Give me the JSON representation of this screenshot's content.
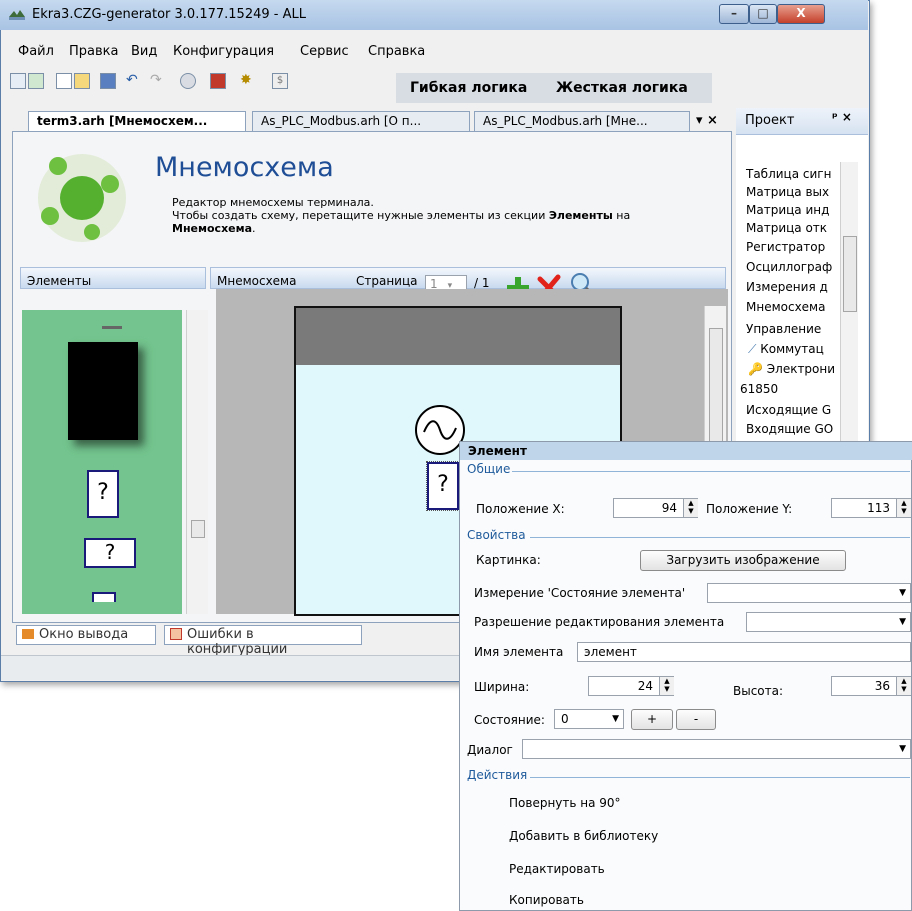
{
  "window": {
    "title": "Ekra3.CZG-generator 3.0.177.15249 - ALL",
    "min_label": "–",
    "max_label": "□",
    "close_label": "X"
  },
  "menu": [
    "Файл",
    "Правка",
    "Вид",
    "Конфигурация",
    "Сервис",
    "Справка"
  ],
  "toolbar": {
    "flex_logic": "Гибкая логика",
    "hard_logic": "Жесткая логика"
  },
  "tabs": [
    {
      "label": "term3.arh [Мнемосхем..."
    },
    {
      "label": "As_PLC_Modbus.arh [О п..."
    },
    {
      "label": "As_PLC_Modbus.arh [Мне..."
    }
  ],
  "tab_controls": "▾ ×",
  "header": {
    "title": "Мнемосхема",
    "desc1": "Редактор мнемосхемы терминала.",
    "desc2a": "Чтобы создать схему, перетащите нужные элементы из секции ",
    "desc2b": "Элементы",
    "desc2c": " на",
    "desc3": "Мнемосхема",
    "desc3b": "."
  },
  "elements_pane": {
    "label": "Элементы"
  },
  "scheme_pane": {
    "label": "Мнемосхема",
    "page_label": "Страница",
    "page_value": "1",
    "page_total": "/ 1"
  },
  "bottom_tabs": [
    "Окно вывода",
    "Ошибки в конфигурации"
  ],
  "project": {
    "title": "Проект",
    "controls": "ᵖ ×",
    "items": [
      "Таблица сигн",
      "Матрица вых",
      "Матрица инд",
      "Матрица отк",
      "Регистратор",
      "Осциллограф",
      "Измерения д",
      "Мнемосхема",
      "Управление",
      "Коммутац",
      "Электрони",
      "61850",
      "Исходящие G",
      "Входящие GO"
    ]
  },
  "props": {
    "title": "Элемент",
    "general": "Общие",
    "pos_x_label": "Положение X:",
    "pos_x": "94",
    "pos_y_label": "Положение Y:",
    "pos_y": "113",
    "properties": "Свойства",
    "picture_label": "Картинка:",
    "load_image": "Загрузить изображение",
    "measure_label": "Измерение 'Состояние элемента'",
    "edit_perm_label": "Разрешение редактирования элемента",
    "name_label": "Имя элемента",
    "name_value": "элемент",
    "width_label": "Ширина:",
    "width_value": "24",
    "height_label": "Высота:",
    "height_value": "36",
    "state_label": "Состояние:",
    "state_value": "0",
    "plus": "+",
    "minus": "-",
    "dialog_label": "Диалог",
    "actions": "Действия",
    "action_items": [
      "Повернуть на 90°",
      "Добавить в библиотеку",
      "Редактировать",
      "Копировать"
    ]
  }
}
